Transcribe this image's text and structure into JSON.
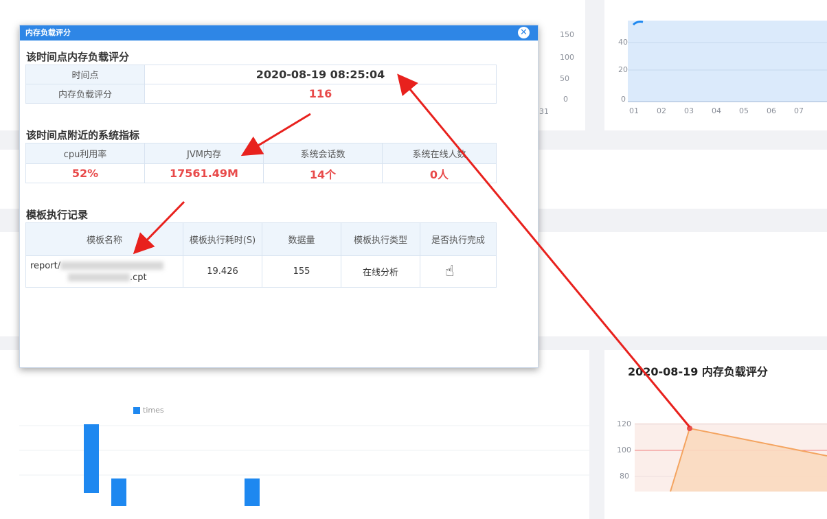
{
  "dialog": {
    "title": "内存负载评分",
    "close_icon": "close-circle-icon"
  },
  "score_section": {
    "title": "该时间点内存负载评分",
    "rows": [
      {
        "label": "时间点",
        "value": "2020-08-19 08:25:04"
      },
      {
        "label": "内存负载评分",
        "value": "116"
      }
    ]
  },
  "metrics_section": {
    "title": "该时间点附近的系统指标",
    "headers": [
      "cpu利用率",
      "JVM内存",
      "系统会话数",
      "系统在线人数"
    ],
    "values": [
      "52%",
      "17561.49M",
      "14个",
      "0人"
    ]
  },
  "template_section": {
    "title": "模板执行记录",
    "headers": [
      "模板名称",
      "模板执行耗时(S)",
      "数据量",
      "模板执行类型",
      "是否执行完成"
    ],
    "row": {
      "name_prefix": "report/",
      "name_suffix": ".cpt",
      "duration": "19.426",
      "data_count": "155",
      "type": "在线分析",
      "done": ""
    }
  },
  "background": {
    "top_left_axis": [
      "150",
      "100",
      "50",
      "0"
    ],
    "top_left_x_tick": "31",
    "top_right_axis": [
      "40",
      "20",
      "0"
    ],
    "top_right_x_ticks": [
      "01",
      "02",
      "03",
      "04",
      "05",
      "06",
      "07"
    ],
    "legend_label": "times",
    "score_chart": {
      "title": "2020-08-19 内存负载评分",
      "y_ticks": [
        "120",
        "100",
        "80"
      ]
    }
  },
  "colors": {
    "header_blue": "#2e86e6",
    "value_red": "#e84a4a",
    "arrow_red": "#e8211d",
    "bar_blue": "#1e88f0",
    "area_orange": "#f4a460"
  }
}
